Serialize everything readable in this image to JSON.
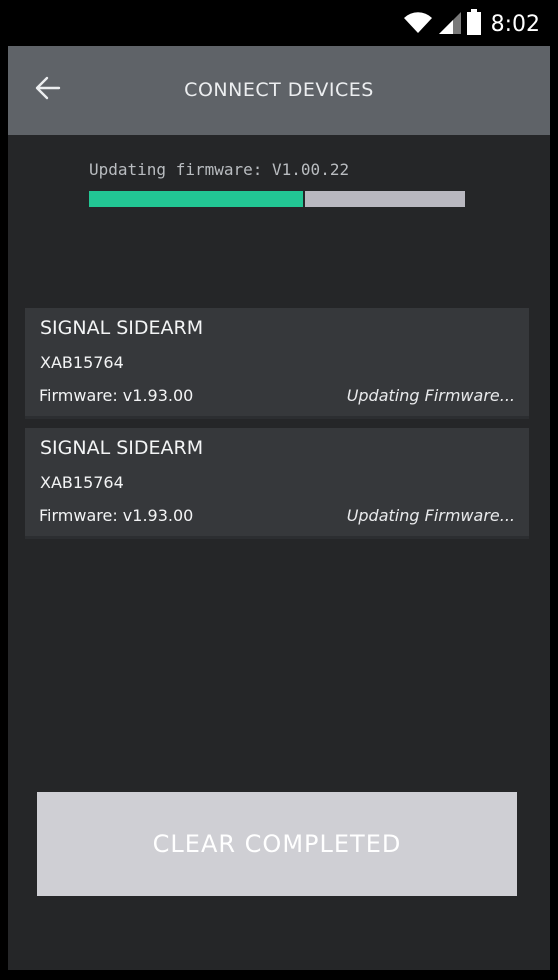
{
  "status_bar": {
    "time": "8:02",
    "icons": [
      "wifi-icon",
      "signal-icon",
      "battery-icon"
    ]
  },
  "app_bar": {
    "title": "CONNECT DEVICES",
    "back_icon": "back-arrow-icon"
  },
  "firmware_update": {
    "label": "Updating firmware: V1.00.22",
    "progress": 0.57,
    "colors": {
      "fill": "#22c694",
      "track": "#b9b8c0"
    }
  },
  "devices": [
    {
      "name": "SIGNAL SIDEARM",
      "serial": "XAB15764",
      "firmware": "Firmware: v1.93.00",
      "status": "Updating Firmware..."
    },
    {
      "name": "SIGNAL SIDEARM",
      "serial": "XAB15764",
      "firmware": "Firmware: v1.93.00",
      "status": "Updating Firmware..."
    }
  ],
  "actions": {
    "clear_label": "CLEAR COMPLETED"
  }
}
